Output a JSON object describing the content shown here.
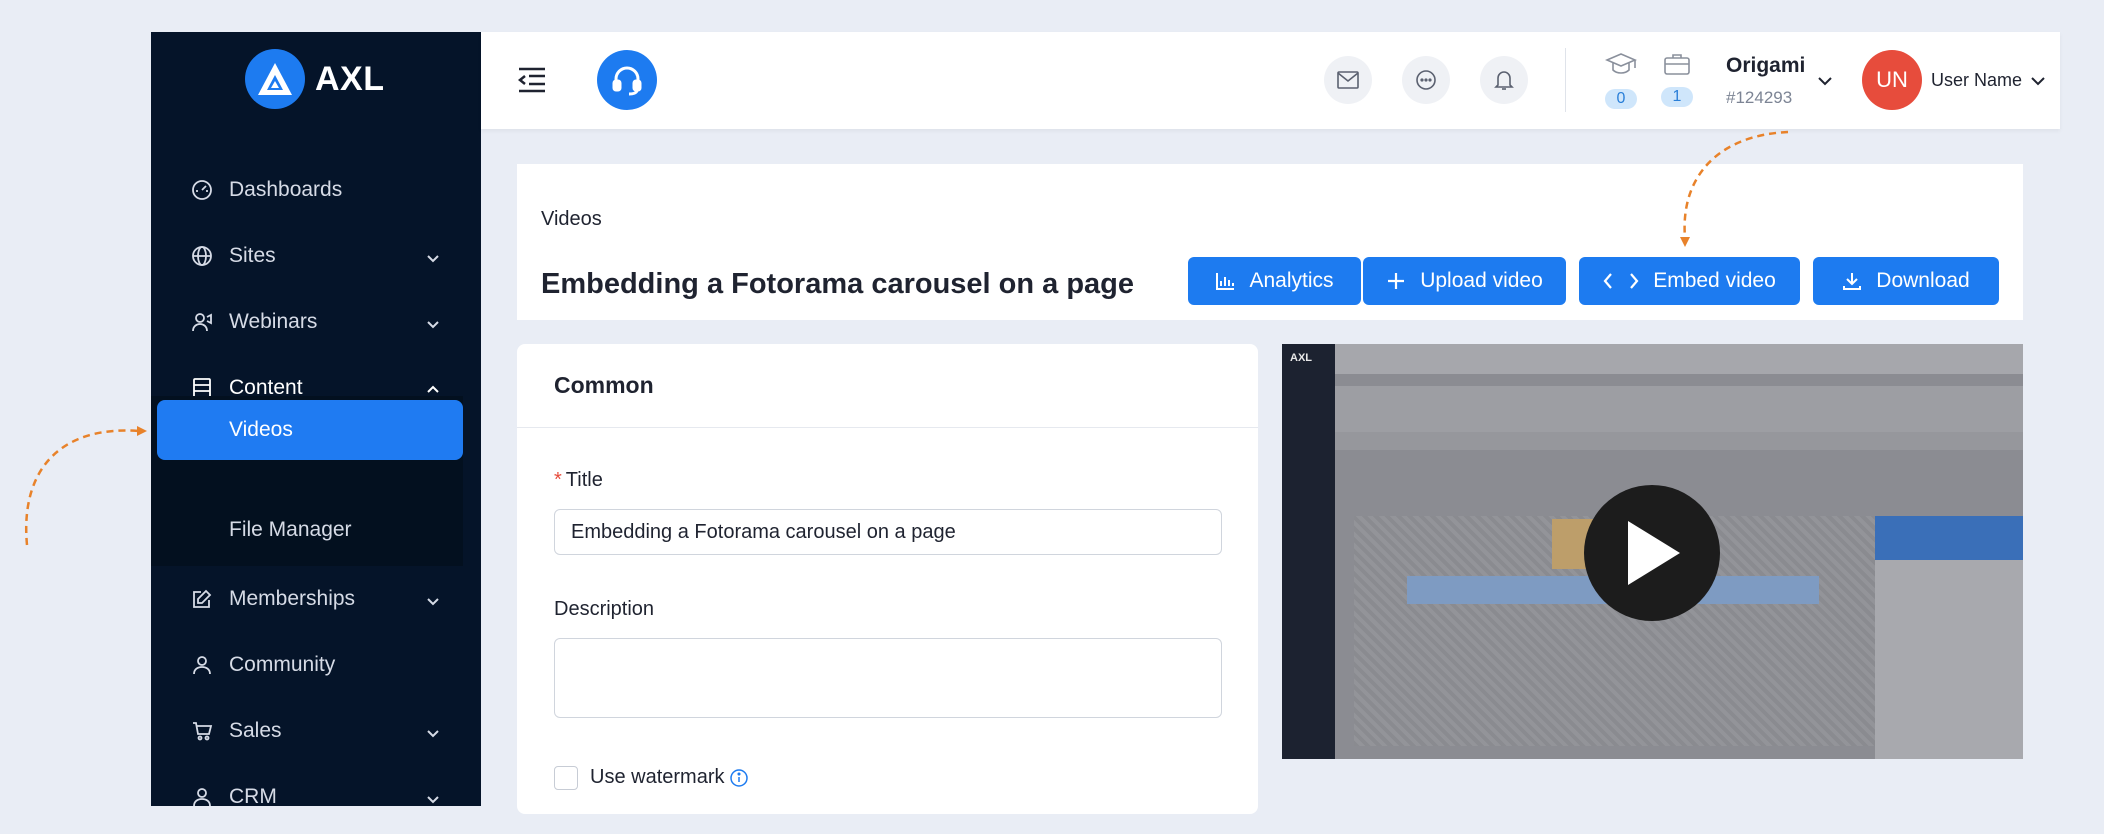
{
  "sidebar": {
    "brand": "AXL",
    "items": [
      {
        "label": "Dashboards"
      },
      {
        "label": "Sites"
      },
      {
        "label": "Webinars"
      },
      {
        "label": "Content"
      },
      {
        "label": "Videos"
      },
      {
        "label": "File Manager"
      },
      {
        "label": "Memberships"
      },
      {
        "label": "Community"
      },
      {
        "label": "Sales"
      },
      {
        "label": "CRM"
      }
    ]
  },
  "topbar": {
    "courses_count": "0",
    "cases_count": "1",
    "org_name": "Origami",
    "org_id": "#124293",
    "avatar_initials": "UN",
    "user_name": "User Name"
  },
  "header": {
    "breadcrumb": "Videos",
    "title": "Embedding a Fotorama carousel on a page",
    "buttons": {
      "analytics": "Analytics",
      "upload": "Upload video",
      "embed": "Embed video",
      "download": "Download"
    }
  },
  "form": {
    "section_title": "Common",
    "title_label": "Title",
    "title_value": "Embedding a Fotorama carousel on a page",
    "description_label": "Description",
    "description_value": "",
    "watermark_label": "Use watermark"
  },
  "video": {
    "thumb_brand": "AXL"
  },
  "colors": {
    "accent": "#1d7bf0",
    "sidebar": "#051429",
    "annotation_arrow": "#e8822a",
    "avatar": "#e74c3c"
  }
}
